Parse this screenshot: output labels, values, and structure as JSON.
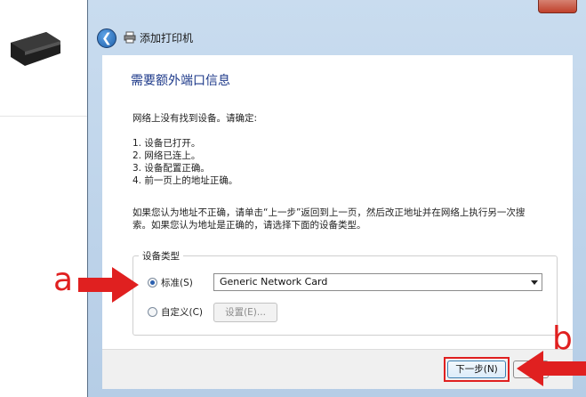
{
  "window": {
    "title": "添加打印机",
    "back_icon": "back-arrow-icon",
    "printer_icon": "printer-icon"
  },
  "page": {
    "heading": "需要额外端口信息",
    "intro": "网络上没有找到设备。请确定:",
    "checklist": [
      "1.  设备已打开。",
      "2.  网络已连上。",
      "3.  设备配置正确。",
      "4.  前一页上的地址正确。"
    ],
    "note_line1": "如果您认为地址不正确，请单击“上一步”返回到上一页，然后改正地址并在网络上执行另一次搜",
    "note_line2": "索。如果您认为地址是正确的，请选择下面的设备类型。"
  },
  "device_type": {
    "group_label": "设备类型",
    "standard_label": "标准(S)",
    "standard_selected": true,
    "standard_value": "Generic Network Card",
    "custom_label": "自定义(C)",
    "custom_selected": false,
    "settings_button": "设置(E)..."
  },
  "footer": {
    "next_button": "下一步(N)"
  },
  "annotations": {
    "a": "a",
    "b": "b",
    "color": "#e02020"
  }
}
